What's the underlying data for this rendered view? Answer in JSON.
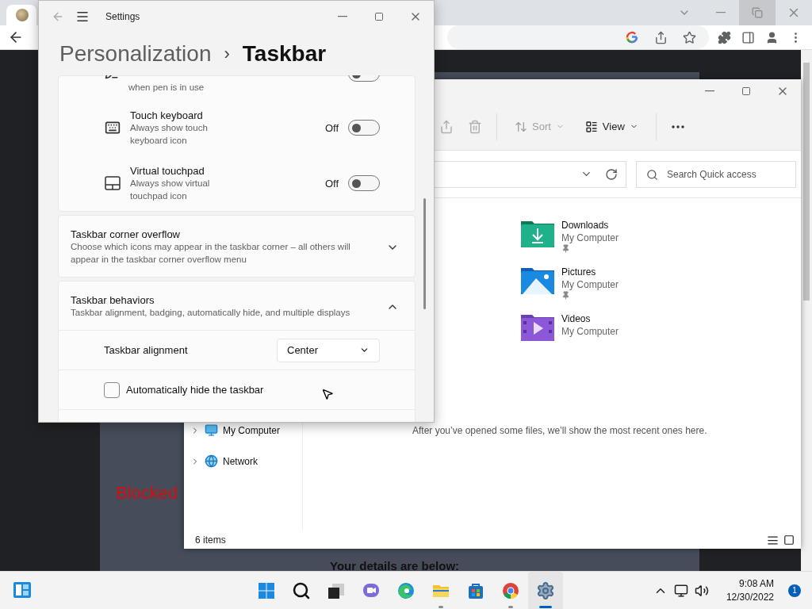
{
  "browser": {
    "page": {
      "blocked_text": "Blocked",
      "details_heading": "Your details are below:"
    }
  },
  "explorer": {
    "toolbar": [
      {
        "label": "Sort",
        "disabled": true
      },
      {
        "label": "View",
        "disabled": false
      }
    ],
    "search": {
      "placeholder": "Search Quick access"
    },
    "quick_access": [
      {
        "kind": "downloads",
        "name": "Downloads",
        "location": "My Computer",
        "pinned": true
      },
      {
        "kind": "pictures",
        "name": "Pictures",
        "location": "My Computer",
        "pinned": true
      },
      {
        "kind": "videos",
        "name": "Videos",
        "location": "My Computer",
        "pinned": false
      }
    ],
    "recent_empty_message": "After you’ve opened some files, we’ll show the most recent ones here.",
    "nav_tree": [
      {
        "kind": "computer",
        "label": "My Computer",
        "expanded": false
      },
      {
        "kind": "network",
        "label": "Network",
        "expanded": false
      }
    ],
    "status_bar": {
      "item_count": "6 items"
    }
  },
  "settings": {
    "window_title": "Settings",
    "breadcrumb": {
      "parent": "Personalization",
      "separator": "›",
      "current": "Taskbar"
    },
    "cards": [
      {
        "kind": "toggle-group",
        "rows": [
          {
            "kind": "pen",
            "description": "when pen is in use",
            "on": false
          },
          {
            "kind": "keyboard",
            "title": "Touch keyboard",
            "description": "Always show touch keyboard icon",
            "state_label": "Off",
            "on": false
          },
          {
            "kind": "touchpad",
            "title": "Virtual touchpad",
            "description": "Always show virtual touchpad icon",
            "state_label": "Off",
            "on": false
          }
        ]
      },
      {
        "kind": "expander",
        "title": "Taskbar corner overflow",
        "description": "Choose which icons may appear in the taskbar corner – all others will appear in the taskbar corner overflow menu",
        "expanded": false
      },
      {
        "kind": "expander",
        "title": "Taskbar behaviors",
        "description": "Taskbar alignment, badging, automatically hide, and multiple displays",
        "expanded": true,
        "options": [
          {
            "kind": "dropdown",
            "label": "Taskbar alignment",
            "value": "Center"
          },
          {
            "kind": "checkbox",
            "label": "Automatically hide the taskbar",
            "checked": false
          }
        ]
      }
    ]
  },
  "taskbar": {
    "apps": [
      {
        "kind": "start",
        "running": false,
        "active": false
      },
      {
        "kind": "search",
        "running": false,
        "active": false
      },
      {
        "kind": "taskview",
        "running": false,
        "active": false
      },
      {
        "kind": "chat",
        "running": false,
        "active": false
      },
      {
        "kind": "edge",
        "running": false,
        "active": false
      },
      {
        "kind": "explorer",
        "running": true,
        "active": false
      },
      {
        "kind": "store",
        "running": false,
        "active": false
      },
      {
        "kind": "chrome",
        "running": true,
        "active": false
      },
      {
        "kind": "settings",
        "running": true,
        "active": true
      }
    ],
    "time": "9:08 AM",
    "date": "12/30/2022",
    "notification_count": "1"
  }
}
